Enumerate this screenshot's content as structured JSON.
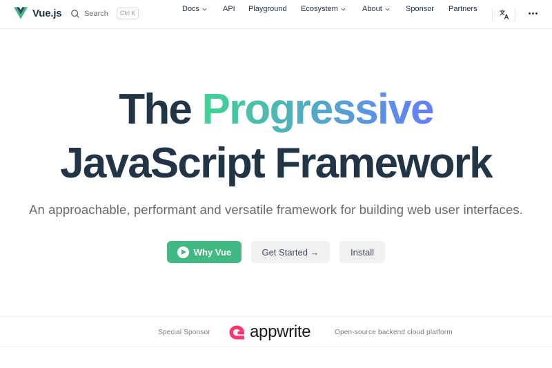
{
  "nav": {
    "logo_text": "Vue.js",
    "search_label": "Search",
    "search_shortcut": "Ctrl K",
    "items": [
      {
        "label": "Docs",
        "dropdown": true
      },
      {
        "label": "API",
        "dropdown": false
      },
      {
        "label": "Playground",
        "dropdown": false
      },
      {
        "label": "Ecosystem",
        "dropdown": true
      },
      {
        "label": "About",
        "dropdown": true
      },
      {
        "label": "Sponsor",
        "dropdown": false
      },
      {
        "label": "Partners",
        "dropdown": false
      }
    ],
    "icons": {
      "logo": "vue-logo-icon",
      "search": "search-icon",
      "translate": "translate-icon",
      "more": "more-dots-icon"
    }
  },
  "hero": {
    "title_plain_1": "The",
    "title_gradient": "Progressive",
    "title_line_2": "JavaScript Framework",
    "tagline": "An approachable, performant and versatile framework for building web user interfaces.",
    "actions": {
      "primary": "Why Vue",
      "get_started": "Get Started →",
      "install": "Install"
    }
  },
  "sponsor": {
    "label": "Special Sponsor",
    "name": "appwrite",
    "description": "Open-source backend cloud platform"
  },
  "colors": {
    "brand_green": "#42b883",
    "gradient_start": "#42d392",
    "gradient_end": "#647eff",
    "text_dark": "#213547",
    "appwrite_pink": "#fd366e"
  }
}
